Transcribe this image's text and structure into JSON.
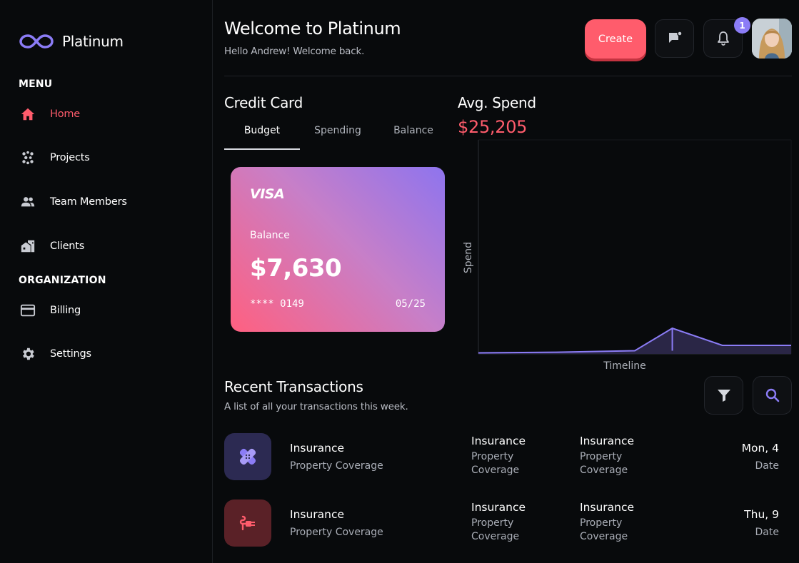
{
  "app": {
    "name": "Platinum",
    "accent": "#ff5c6c",
    "brand_color": "#8b7cf6"
  },
  "sidebar": {
    "menu_label": "MENU",
    "org_label": "ORGANIZATION",
    "items": [
      {
        "label": "Home",
        "icon": "home-icon",
        "active": true
      },
      {
        "label": "Projects",
        "icon": "projects-icon"
      },
      {
        "label": "Team Members",
        "icon": "team-icon"
      },
      {
        "label": "Clients",
        "icon": "clients-icon"
      },
      {
        "label": "Billing",
        "icon": "billing-icon"
      },
      {
        "label": "Settings",
        "icon": "settings-icon"
      }
    ]
  },
  "header": {
    "title": "Welcome to Platinum",
    "subtitle": "Hello Andrew! Welcome back.",
    "create_label": "Create",
    "notification_count": "1"
  },
  "credit_card": {
    "title": "Credit Card",
    "tabs": [
      "Budget",
      "Spending",
      "Balance"
    ],
    "active_tab": "Budget",
    "card": {
      "brand": "VISA",
      "balance_label": "Balance",
      "balance": "$7,630",
      "number": "**** 0149",
      "expiry": "05/25"
    }
  },
  "avg_spend": {
    "title": "Avg. Spend",
    "value": "$25,205",
    "chart_data": {
      "type": "area",
      "xlabel": "Timeline",
      "ylabel": "Spend",
      "x": [
        0,
        1,
        2,
        3,
        4,
        5
      ],
      "values": [
        0.5,
        0.8,
        1.5,
        12,
        4,
        4
      ],
      "ylim": [
        0,
        100
      ],
      "grid": false,
      "line_color": "#8b7cf6",
      "fill_color": "#2a2646"
    }
  },
  "transactions": {
    "title": "Recent Transactions",
    "subtitle": "A list of all your transactions this week.",
    "rows": [
      {
        "icon": "bandage-icon",
        "name": "Insurance",
        "sub": "Property Coverage",
        "col1_title": "Insurance",
        "col1_sub": "Property Coverage",
        "col2_title": "Insurance",
        "col2_sub": "Property Coverage",
        "date": "Mon, 4",
        "date_label": "Date"
      },
      {
        "icon": "plug-icon",
        "name": "Insurance",
        "sub": "Property Coverage",
        "col1_title": "Insurance",
        "col1_sub": "Property Coverage",
        "col2_title": "Insurance",
        "col2_sub": "Property Coverage",
        "date": "Thu, 9",
        "date_label": "Date"
      }
    ]
  }
}
